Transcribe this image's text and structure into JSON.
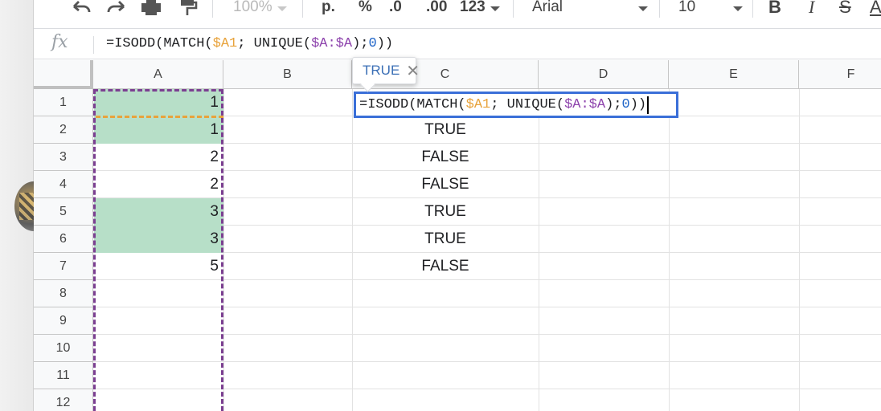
{
  "toolbar": {
    "zoom": "100%",
    "format_currency_label": "р.",
    "format_percent_label": "%",
    "decrease_decimal_label": ".0",
    "increase_decimal_label": ".00",
    "more_formats_label": "123",
    "font_name": "Arial",
    "font_size": "10",
    "bold_label": "B",
    "italic_label": "I",
    "strikethrough_label": "S",
    "text_color_label": "A"
  },
  "formula_bar": {
    "fx_label": "fx",
    "formula_parts": [
      "=ISODD(MATCH(",
      "$A1",
      "; UNIQUE(",
      "$A:$A",
      ");",
      "0",
      "))"
    ]
  },
  "grid": {
    "columns": [
      "A",
      "B",
      "C",
      "D",
      "E",
      "F"
    ],
    "rows": [
      "1",
      "2",
      "3",
      "4",
      "5",
      "6",
      "7",
      "8",
      "9",
      "10",
      "11",
      "12"
    ],
    "column_a_values": [
      "1",
      "1",
      "2",
      "2",
      "3",
      "3",
      "5"
    ],
    "column_c_values": [
      "",
      "TRUE",
      "FALSE",
      "FALSE",
      "TRUE",
      "TRUE",
      "FALSE"
    ]
  },
  "tooltip": {
    "value": "TRUE",
    "close_label": "✕"
  },
  "colors": {
    "highlight": "#b7dfc8",
    "range_purple": "#7b3f91",
    "range_orange": "#e8a33c",
    "editor_border": "#3a6fd8"
  }
}
